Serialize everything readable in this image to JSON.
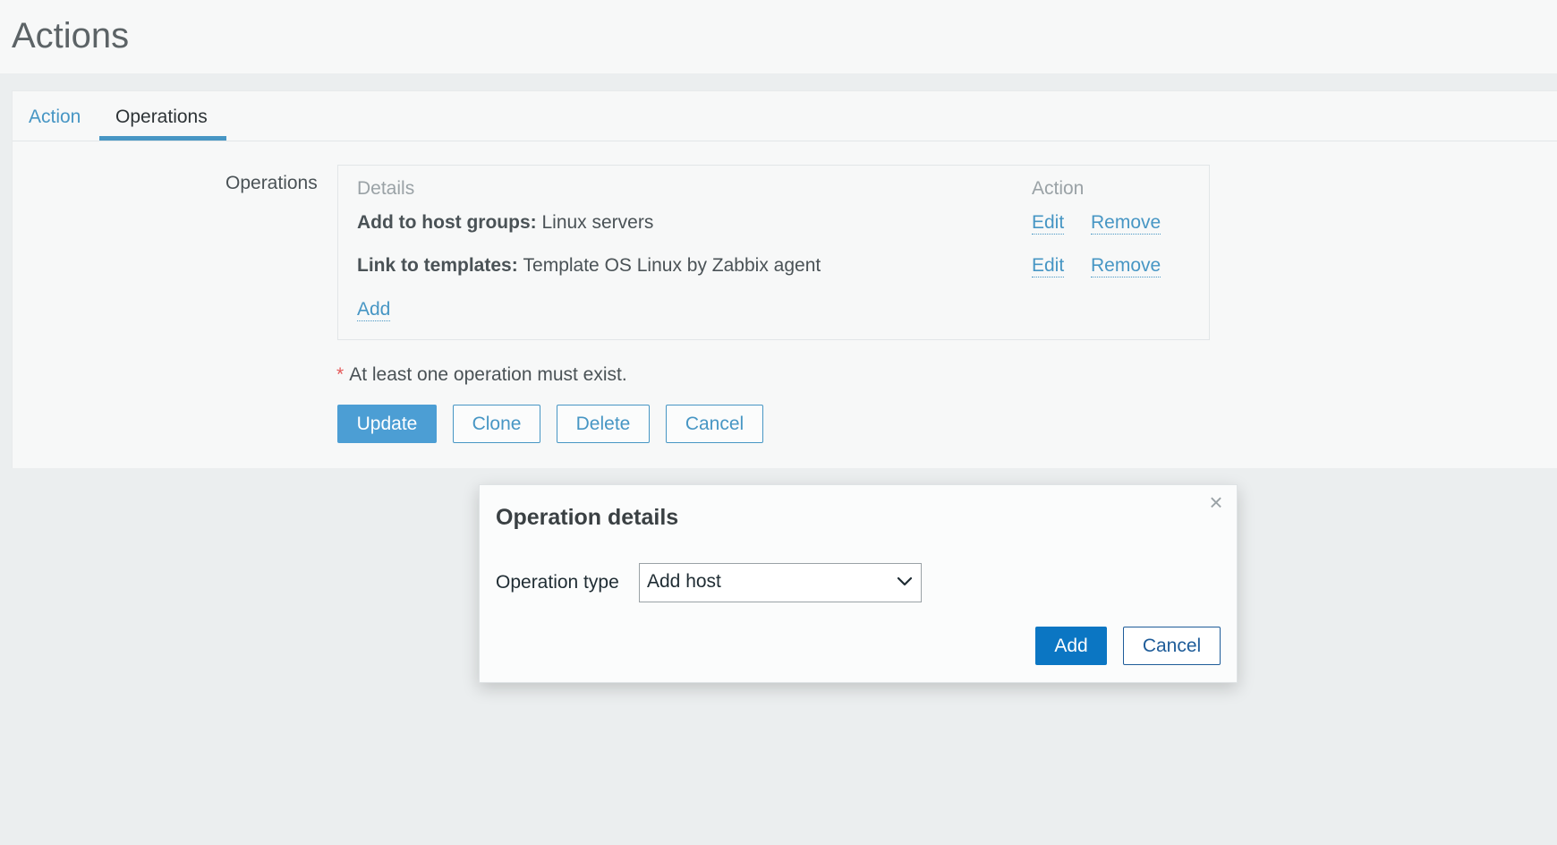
{
  "header": {
    "title": "Actions"
  },
  "tabs": [
    {
      "label": "Action",
      "active": false
    },
    {
      "label": "Operations",
      "active": true
    }
  ],
  "form": {
    "operations_label": "Operations",
    "table": {
      "headers": {
        "details": "Details",
        "action": "Action"
      },
      "rows": [
        {
          "key": "Add to host groups:",
          "value": "Linux servers",
          "edit": "Edit",
          "remove": "Remove"
        },
        {
          "key": "Link to templates:",
          "value": "Template OS Linux by Zabbix agent",
          "edit": "Edit",
          "remove": "Remove"
        }
      ],
      "add_link": "Add"
    },
    "note": {
      "star": "*",
      "text": "At least one operation must exist."
    },
    "buttons": {
      "update": "Update",
      "clone": "Clone",
      "delete": "Delete",
      "cancel": "Cancel"
    }
  },
  "modal": {
    "title": "Operation details",
    "close_icon": "×",
    "operation_type_label": "Operation type",
    "operation_type_value": "Add host",
    "add_button": "Add",
    "cancel_button": "Cancel"
  },
  "colors": {
    "accent": "#4796c4",
    "primary_button": "#0b76c3",
    "required_star": "#e45959"
  }
}
